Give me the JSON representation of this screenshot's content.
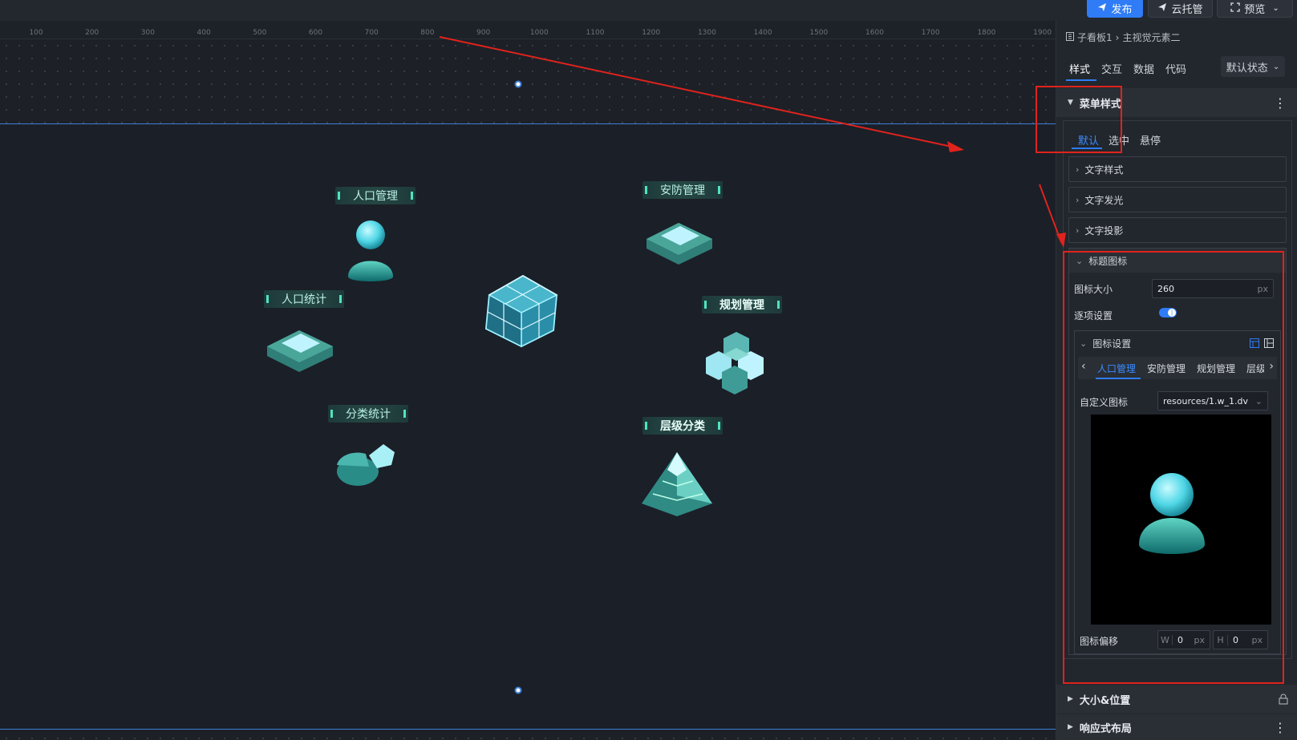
{
  "topbar": {
    "publish_label": "发布",
    "cloud_label": "云托管",
    "preview_label": "预览"
  },
  "ruler": [
    "100",
    "200",
    "300",
    "400",
    "500",
    "600",
    "700",
    "800",
    "900",
    "1000",
    "1100",
    "1200",
    "1300",
    "1400",
    "1500",
    "1600",
    "1700",
    "1800",
    "1900"
  ],
  "canvas": {
    "modules": [
      {
        "label": "人口管理",
        "icon": "person-icon"
      },
      {
        "label": "安防管理",
        "icon": "panel-icon"
      },
      {
        "label": "人口统计",
        "icon": "panel-icon"
      },
      {
        "label": "规划管理",
        "icon": "cubes-icon"
      },
      {
        "label": "分类统计",
        "icon": "pie-chart-icon"
      },
      {
        "label": "层级分类",
        "icon": "pyramid-icon"
      }
    ],
    "center_icon": "cube-icon"
  },
  "panel": {
    "breadcrumb": {
      "parent": "子看板1",
      "current": "主视觉元素二"
    },
    "tabs": [
      "样式",
      "交互",
      "数据",
      "代码"
    ],
    "state_select": "默认状态",
    "menu_section": "菜单样式",
    "sub_tabs": [
      "默认",
      "选中",
      "悬停"
    ],
    "accordions": [
      "文字样式",
      "文字发光",
      "文字投影"
    ],
    "title_icon": {
      "header": "标题图标",
      "size_label": "图标大小",
      "size_value": "260",
      "size_unit": "px",
      "per_item_label": "逐项设置",
      "per_item_enabled": true
    },
    "icon_settings": {
      "header": "图标设置",
      "tabs": [
        "人口管理",
        "安防管理",
        "规划管理",
        "层级"
      ],
      "active_tab": "人口管理",
      "custom_label": "自定义图标",
      "custom_value": "resources/1.w_1.dv",
      "offset_label": "图标偏移",
      "w_label": "W",
      "w_value": "0",
      "h_label": "H",
      "h_value": "0",
      "unit": "px"
    },
    "bottom_sections": [
      "大小&位置",
      "响应式布局"
    ]
  },
  "colors": {
    "accent": "#2f7cf6",
    "annotation": "#e0231c",
    "label_glow": "#4fe3c0"
  }
}
